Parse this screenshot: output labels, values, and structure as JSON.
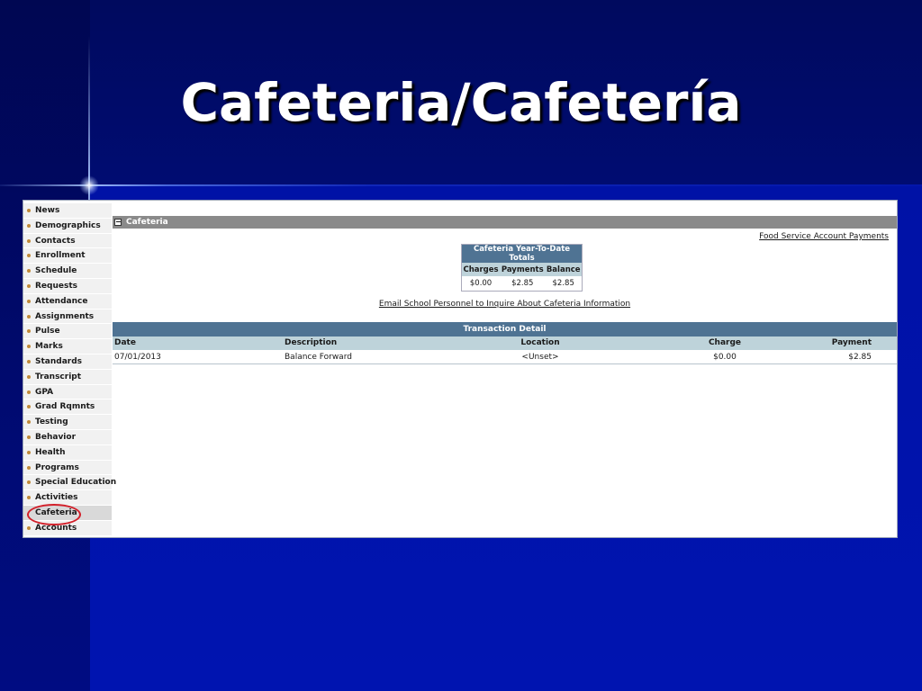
{
  "slide": {
    "title": "Cafeteria/Cafetería"
  },
  "sidebar": {
    "items": [
      {
        "label": "News"
      },
      {
        "label": "Demographics"
      },
      {
        "label": "Contacts"
      },
      {
        "label": "Enrollment"
      },
      {
        "label": "Schedule"
      },
      {
        "label": "Requests"
      },
      {
        "label": "Attendance"
      },
      {
        "label": "Assignments"
      },
      {
        "label": "Pulse"
      },
      {
        "label": "Marks"
      },
      {
        "label": "Standards"
      },
      {
        "label": "Transcript"
      },
      {
        "label": "GPA"
      },
      {
        "label": "Grad Rqmnts"
      },
      {
        "label": "Testing"
      },
      {
        "label": "Behavior"
      },
      {
        "label": "Health"
      },
      {
        "label": "Programs"
      },
      {
        "label": "Special Education"
      },
      {
        "label": "Activities"
      },
      {
        "label": "Cafeteria"
      },
      {
        "label": "Accounts"
      }
    ],
    "active": "Cafeteria"
  },
  "section": {
    "title": "Cafeteria",
    "collapse_symbol": "−"
  },
  "links": {
    "food_service": "Food Service Account Payments",
    "email": "Email School Personnel to Inquire About Cafeteria Information"
  },
  "ytd": {
    "title": "Cafeteria Year-To-Date Totals",
    "headers": [
      "Charges",
      "Payments",
      "Balance"
    ],
    "values": [
      "$0.00",
      "$2.85",
      "$2.85"
    ]
  },
  "transactions": {
    "title": "Transaction Detail",
    "columns": [
      "Date",
      "Description",
      "Location",
      "Charge",
      "Payment"
    ],
    "rows": [
      [
        "07/01/2013",
        "Balance Forward",
        "<Unset>",
        "$0.00",
        "$2.85"
      ]
    ]
  },
  "colors": {
    "table_header": "#4f7393",
    "column_header": "#bed3da",
    "section_header": "#8a8a8a",
    "highlight": "#d2202a"
  }
}
